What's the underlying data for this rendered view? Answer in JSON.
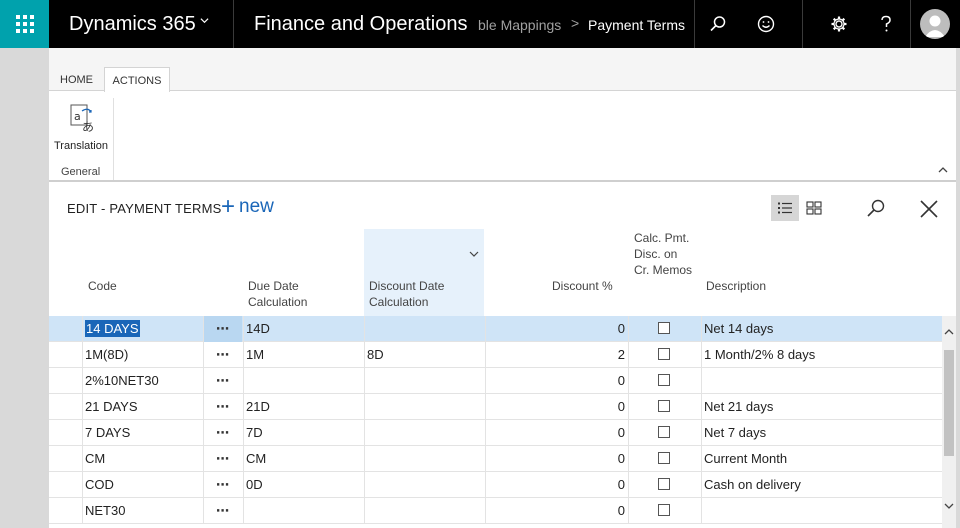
{
  "topbar": {
    "app_title": "Dynamics 365",
    "module_title": "Finance and Operations",
    "breadcrumb": [
      "ble Mappings",
      "Payment Terms"
    ],
    "breadcrumb_sep": ">",
    "icons": [
      "waffle-icon",
      "search-icon",
      "smiley-icon",
      "gear-icon",
      "help-icon",
      "user-avatar-icon"
    ],
    "accent_color": "#00a2ad"
  },
  "ribbon": {
    "tabs": [
      "HOME",
      "ACTIONS"
    ],
    "active_tab": "ACTIONS",
    "translation_label": "Translation",
    "group_label": "General"
  },
  "page": {
    "caption": "EDIT - PAYMENT TERMS",
    "new_label": "new",
    "accent_color": "#1a66b8"
  },
  "grid": {
    "columns": {
      "code": "Code",
      "due_date": "Due Date Calculation",
      "discount_date": "Discount Date Calculation",
      "discount_pct": "Discount %",
      "calc_pmt": "Calc. Pmt. Disc. on Cr. Memos",
      "description": "Description"
    },
    "more_glyph": "⋯",
    "rows": [
      {
        "code": "14 DAYS",
        "due": "14D",
        "disc_date": "",
        "disc_pct": "0",
        "calc": false,
        "desc": "Net 14 days"
      },
      {
        "code": "1M(8D)",
        "due": "1M",
        "disc_date": "8D",
        "disc_pct": "2",
        "calc": false,
        "desc": "1 Month/2% 8 days"
      },
      {
        "code": "2%10NET30",
        "due": "",
        "disc_date": "",
        "disc_pct": "0",
        "calc": false,
        "desc": ""
      },
      {
        "code": "21 DAYS",
        "due": "21D",
        "disc_date": "",
        "disc_pct": "0",
        "calc": false,
        "desc": "Net 21 days"
      },
      {
        "code": "7 DAYS",
        "due": "7D",
        "disc_date": "",
        "disc_pct": "0",
        "calc": false,
        "desc": "Net 7 days"
      },
      {
        "code": "CM",
        "due": "CM",
        "disc_date": "",
        "disc_pct": "0",
        "calc": false,
        "desc": "Current Month"
      },
      {
        "code": "COD",
        "due": "0D",
        "disc_date": "",
        "disc_pct": "0",
        "calc": false,
        "desc": "Cash on delivery"
      },
      {
        "code": "NET30",
        "due": "",
        "disc_date": "",
        "disc_pct": "0",
        "calc": false,
        "desc": ""
      }
    ]
  }
}
